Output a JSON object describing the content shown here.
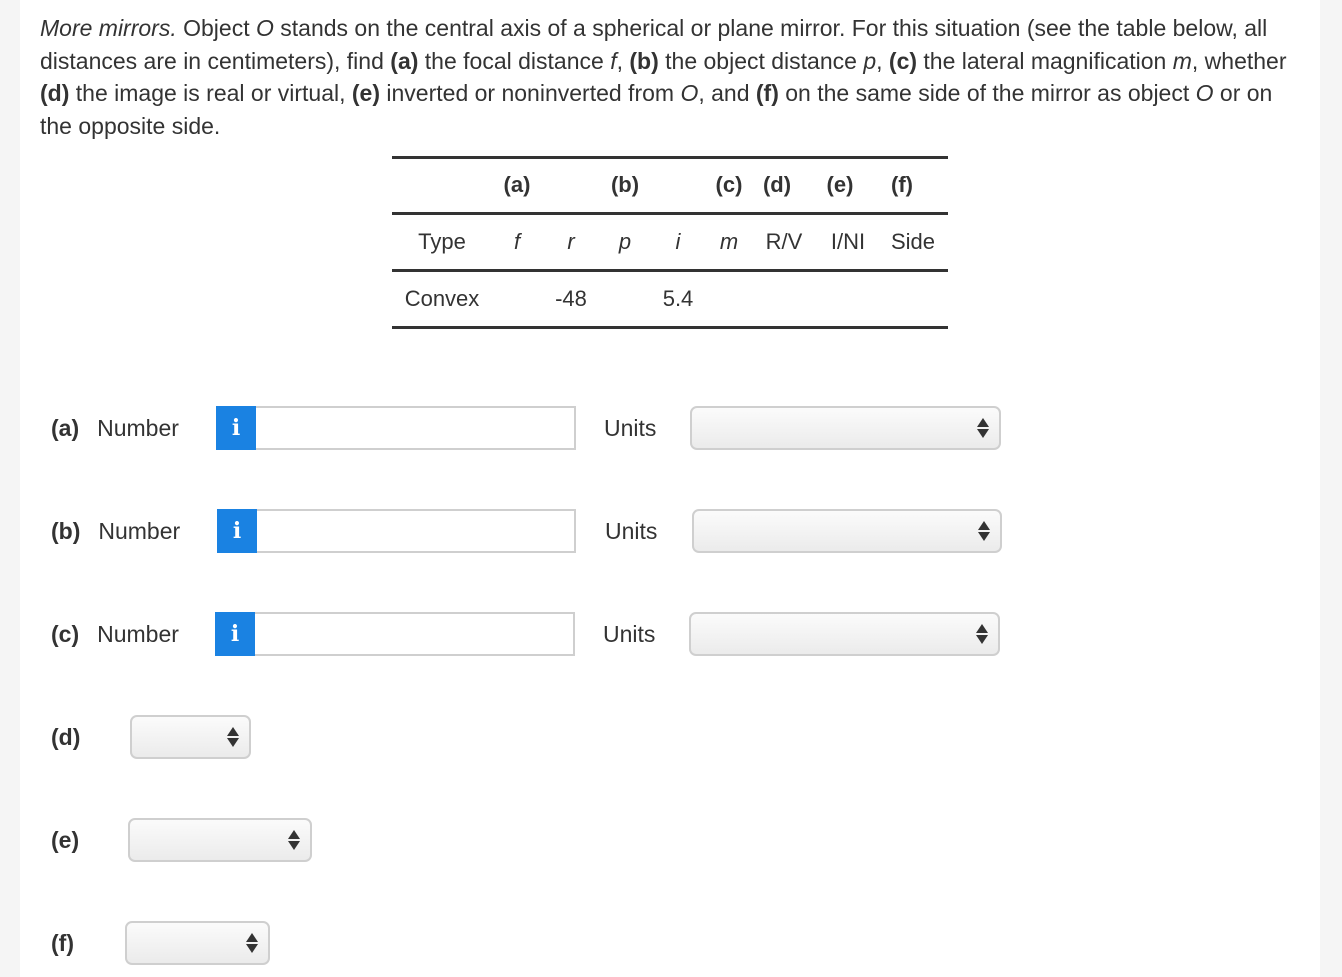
{
  "question": {
    "lead": "More mirrors.",
    "t1": " Object ",
    "O1": "O",
    "t2": " stands on the central axis of a spherical or plane mirror. For this situation (see the table below, all distances are in centimeters), find ",
    "a": "(a)",
    "t3": " the focal distance ",
    "f": "f",
    "t4": ", ",
    "b": "(b)",
    "t5": " the object distance ",
    "p": "p",
    "t6": ", ",
    "c": "(c)",
    "t7": " the lateral magnification ",
    "m": "m",
    "t8": ", whether ",
    "d": "(d)",
    "t9": " the image is real or virtual, ",
    "e": "(e)",
    "t10": " inverted or noninverted from ",
    "O2": "O",
    "t11": ", and ",
    "fpart": "(f)",
    "t12": " on the same side of the mirror as object ",
    "O3": "O",
    "t13": " or on the opposite side."
  },
  "table": {
    "parts": [
      "(a)",
      "(b)",
      "(c)",
      "(d)",
      "(e)",
      "(f)"
    ],
    "headers": [
      "Type",
      "f",
      "r",
      "p",
      "i",
      "m",
      "R/V",
      "I/NI",
      "Side"
    ],
    "row": {
      "type": "Convex",
      "r": "-48",
      "i": "5.4"
    }
  },
  "answers": {
    "a": {
      "part": "(a)",
      "label": "Number",
      "info": "i",
      "value": "",
      "units_label": "Units",
      "units_value": ""
    },
    "b": {
      "part": "(b)",
      "label": "Number",
      "info": "i",
      "value": "",
      "units_label": "Units",
      "units_value": ""
    },
    "c": {
      "part": "(c)",
      "label": "Number",
      "info": "i",
      "value": "",
      "units_label": "Units",
      "units_value": ""
    },
    "d": {
      "part": "(d)",
      "value": ""
    },
    "e": {
      "part": "(e)",
      "value": ""
    },
    "f": {
      "part": "(f)",
      "value": ""
    }
  },
  "colors": {
    "info_button": "#1a82e2",
    "rule": "#333333"
  }
}
